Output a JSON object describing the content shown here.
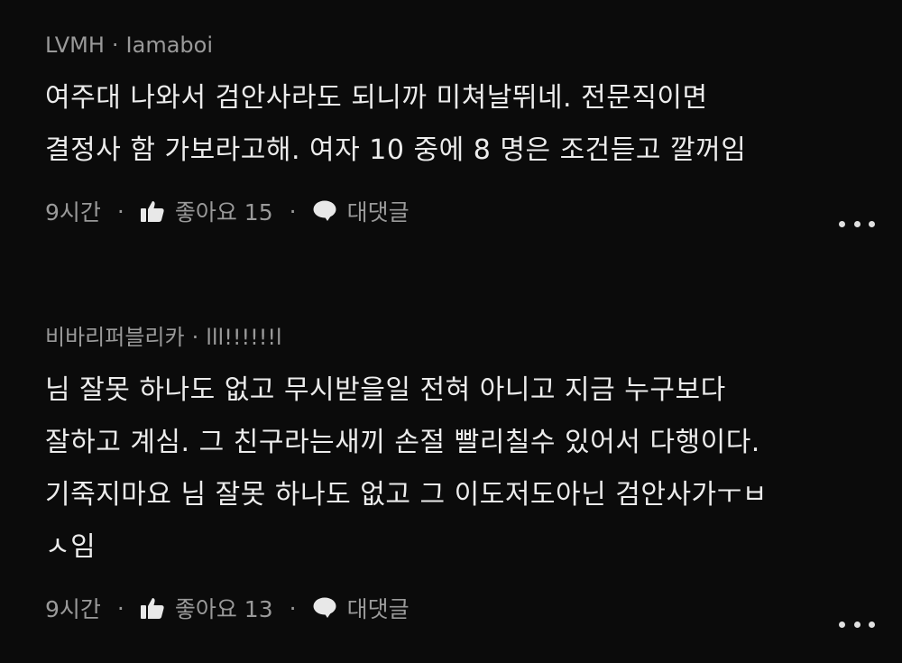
{
  "comments": [
    {
      "author": "LVMH",
      "badge": "Iamaboi",
      "lines": [
        "여주대 나와서 검안사라도 되니까 미쳐날뛰네.  전문직이면",
        "결정사 함 가보라고해. 여자 10 중에 8 명은 조건듣고 깔꺼임"
      ],
      "time": "9시간",
      "like_label": "좋아요 15",
      "reply_label": "대댓글",
      "like_icon": "thumbs-up-icon",
      "reply_icon": "speech-bubble-icon",
      "more_icon": "more-horizontal-icon"
    },
    {
      "author": "비바리퍼블리카",
      "badge": "lll!!!!!!l",
      "lines": [
        "님 잘못 하나도 없고 무시받을일 전혀 아니고 지금 누구보다",
        "잘하고 계심. 그 친구라는새끼 손절 빨리칠수 있어서 다행이다.",
        "기죽지마요 님 잘못 하나도 없고 그 이도저도아닌 검안사가ㅜㅂ",
        "ㅅ임"
      ],
      "time": "9시간",
      "like_label": "좋아요 13",
      "reply_label": "대댓글",
      "like_icon": "thumbs-up-icon",
      "reply_icon": "speech-bubble-icon",
      "more_icon": "more-horizontal-icon"
    }
  ],
  "separator": "·",
  "colors": {
    "background": "#0b0b0b",
    "text": "#ececec",
    "muted": "#9a9a9a"
  }
}
